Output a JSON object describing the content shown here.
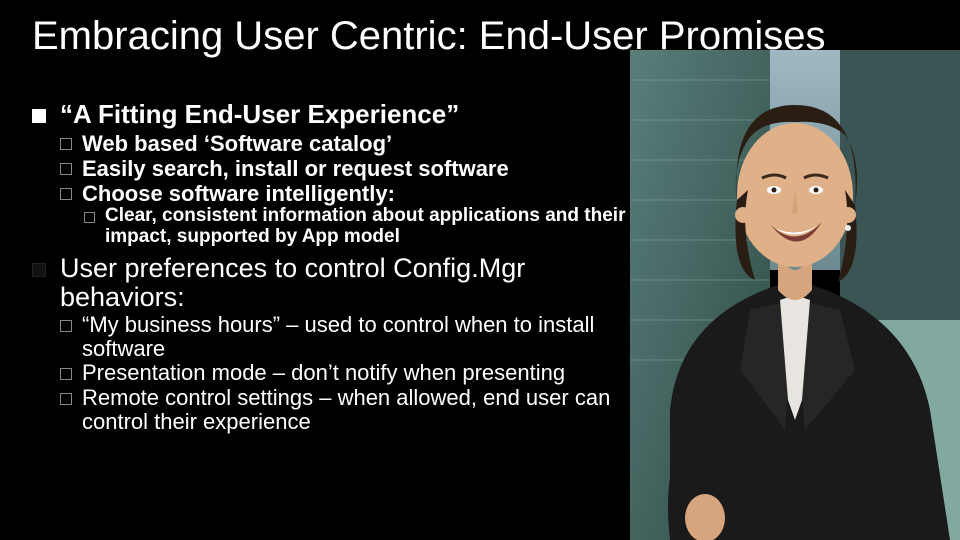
{
  "title": "Embracing User Centric: End-User Promises",
  "sections": {
    "s1": {
      "heading": "“A Fitting End-User Experience”",
      "items": {
        "a": "Web based ‘Software catalog’",
        "b": "Easily search, install or request software",
        "c": "Choose software intelligently:",
        "c_sub": "Clear, consistent information about applications and their impact, supported by App model"
      }
    },
    "s2": {
      "heading": "User preferences to control Config.Mgr behaviors:",
      "items": {
        "a": "“My business hours” – used to control when to install software",
        "b": "Presentation mode – don’t notify when presenting",
        "c": "Remote control settings – when allowed, end user can control their experience"
      }
    }
  }
}
